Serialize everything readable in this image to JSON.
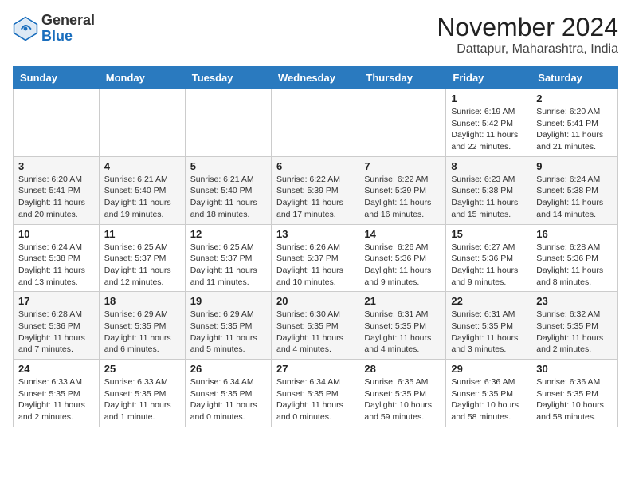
{
  "header": {
    "logo": {
      "general": "General",
      "blue": "Blue"
    },
    "title": "November 2024",
    "location": "Dattapur, Maharashtra, India"
  },
  "calendar": {
    "days_of_week": [
      "Sunday",
      "Monday",
      "Tuesday",
      "Wednesday",
      "Thursday",
      "Friday",
      "Saturday"
    ],
    "weeks": [
      [
        {
          "day": "",
          "sunrise": "",
          "sunset": "",
          "daylight": ""
        },
        {
          "day": "",
          "sunrise": "",
          "sunset": "",
          "daylight": ""
        },
        {
          "day": "",
          "sunrise": "",
          "sunset": "",
          "daylight": ""
        },
        {
          "day": "",
          "sunrise": "",
          "sunset": "",
          "daylight": ""
        },
        {
          "day": "",
          "sunrise": "",
          "sunset": "",
          "daylight": ""
        },
        {
          "day": "1",
          "sunrise": "Sunrise: 6:19 AM",
          "sunset": "Sunset: 5:42 PM",
          "daylight": "Daylight: 11 hours and 22 minutes."
        },
        {
          "day": "2",
          "sunrise": "Sunrise: 6:20 AM",
          "sunset": "Sunset: 5:41 PM",
          "daylight": "Daylight: 11 hours and 21 minutes."
        }
      ],
      [
        {
          "day": "3",
          "sunrise": "Sunrise: 6:20 AM",
          "sunset": "Sunset: 5:41 PM",
          "daylight": "Daylight: 11 hours and 20 minutes."
        },
        {
          "day": "4",
          "sunrise": "Sunrise: 6:21 AM",
          "sunset": "Sunset: 5:40 PM",
          "daylight": "Daylight: 11 hours and 19 minutes."
        },
        {
          "day": "5",
          "sunrise": "Sunrise: 6:21 AM",
          "sunset": "Sunset: 5:40 PM",
          "daylight": "Daylight: 11 hours and 18 minutes."
        },
        {
          "day": "6",
          "sunrise": "Sunrise: 6:22 AM",
          "sunset": "Sunset: 5:39 PM",
          "daylight": "Daylight: 11 hours and 17 minutes."
        },
        {
          "day": "7",
          "sunrise": "Sunrise: 6:22 AM",
          "sunset": "Sunset: 5:39 PM",
          "daylight": "Daylight: 11 hours and 16 minutes."
        },
        {
          "day": "8",
          "sunrise": "Sunrise: 6:23 AM",
          "sunset": "Sunset: 5:38 PM",
          "daylight": "Daylight: 11 hours and 15 minutes."
        },
        {
          "day": "9",
          "sunrise": "Sunrise: 6:24 AM",
          "sunset": "Sunset: 5:38 PM",
          "daylight": "Daylight: 11 hours and 14 minutes."
        }
      ],
      [
        {
          "day": "10",
          "sunrise": "Sunrise: 6:24 AM",
          "sunset": "Sunset: 5:38 PM",
          "daylight": "Daylight: 11 hours and 13 minutes."
        },
        {
          "day": "11",
          "sunrise": "Sunrise: 6:25 AM",
          "sunset": "Sunset: 5:37 PM",
          "daylight": "Daylight: 11 hours and 12 minutes."
        },
        {
          "day": "12",
          "sunrise": "Sunrise: 6:25 AM",
          "sunset": "Sunset: 5:37 PM",
          "daylight": "Daylight: 11 hours and 11 minutes."
        },
        {
          "day": "13",
          "sunrise": "Sunrise: 6:26 AM",
          "sunset": "Sunset: 5:37 PM",
          "daylight": "Daylight: 11 hours and 10 minutes."
        },
        {
          "day": "14",
          "sunrise": "Sunrise: 6:26 AM",
          "sunset": "Sunset: 5:36 PM",
          "daylight": "Daylight: 11 hours and 9 minutes."
        },
        {
          "day": "15",
          "sunrise": "Sunrise: 6:27 AM",
          "sunset": "Sunset: 5:36 PM",
          "daylight": "Daylight: 11 hours and 9 minutes."
        },
        {
          "day": "16",
          "sunrise": "Sunrise: 6:28 AM",
          "sunset": "Sunset: 5:36 PM",
          "daylight": "Daylight: 11 hours and 8 minutes."
        }
      ],
      [
        {
          "day": "17",
          "sunrise": "Sunrise: 6:28 AM",
          "sunset": "Sunset: 5:36 PM",
          "daylight": "Daylight: 11 hours and 7 minutes."
        },
        {
          "day": "18",
          "sunrise": "Sunrise: 6:29 AM",
          "sunset": "Sunset: 5:35 PM",
          "daylight": "Daylight: 11 hours and 6 minutes."
        },
        {
          "day": "19",
          "sunrise": "Sunrise: 6:29 AM",
          "sunset": "Sunset: 5:35 PM",
          "daylight": "Daylight: 11 hours and 5 minutes."
        },
        {
          "day": "20",
          "sunrise": "Sunrise: 6:30 AM",
          "sunset": "Sunset: 5:35 PM",
          "daylight": "Daylight: 11 hours and 4 minutes."
        },
        {
          "day": "21",
          "sunrise": "Sunrise: 6:31 AM",
          "sunset": "Sunset: 5:35 PM",
          "daylight": "Daylight: 11 hours and 4 minutes."
        },
        {
          "day": "22",
          "sunrise": "Sunrise: 6:31 AM",
          "sunset": "Sunset: 5:35 PM",
          "daylight": "Daylight: 11 hours and 3 minutes."
        },
        {
          "day": "23",
          "sunrise": "Sunrise: 6:32 AM",
          "sunset": "Sunset: 5:35 PM",
          "daylight": "Daylight: 11 hours and 2 minutes."
        }
      ],
      [
        {
          "day": "24",
          "sunrise": "Sunrise: 6:33 AM",
          "sunset": "Sunset: 5:35 PM",
          "daylight": "Daylight: 11 hours and 2 minutes."
        },
        {
          "day": "25",
          "sunrise": "Sunrise: 6:33 AM",
          "sunset": "Sunset: 5:35 PM",
          "daylight": "Daylight: 11 hours and 1 minute."
        },
        {
          "day": "26",
          "sunrise": "Sunrise: 6:34 AM",
          "sunset": "Sunset: 5:35 PM",
          "daylight": "Daylight: 11 hours and 0 minutes."
        },
        {
          "day": "27",
          "sunrise": "Sunrise: 6:34 AM",
          "sunset": "Sunset: 5:35 PM",
          "daylight": "Daylight: 11 hours and 0 minutes."
        },
        {
          "day": "28",
          "sunrise": "Sunrise: 6:35 AM",
          "sunset": "Sunset: 5:35 PM",
          "daylight": "Daylight: 10 hours and 59 minutes."
        },
        {
          "day": "29",
          "sunrise": "Sunrise: 6:36 AM",
          "sunset": "Sunset: 5:35 PM",
          "daylight": "Daylight: 10 hours and 58 minutes."
        },
        {
          "day": "30",
          "sunrise": "Sunrise: 6:36 AM",
          "sunset": "Sunset: 5:35 PM",
          "daylight": "Daylight: 10 hours and 58 minutes."
        }
      ]
    ]
  }
}
